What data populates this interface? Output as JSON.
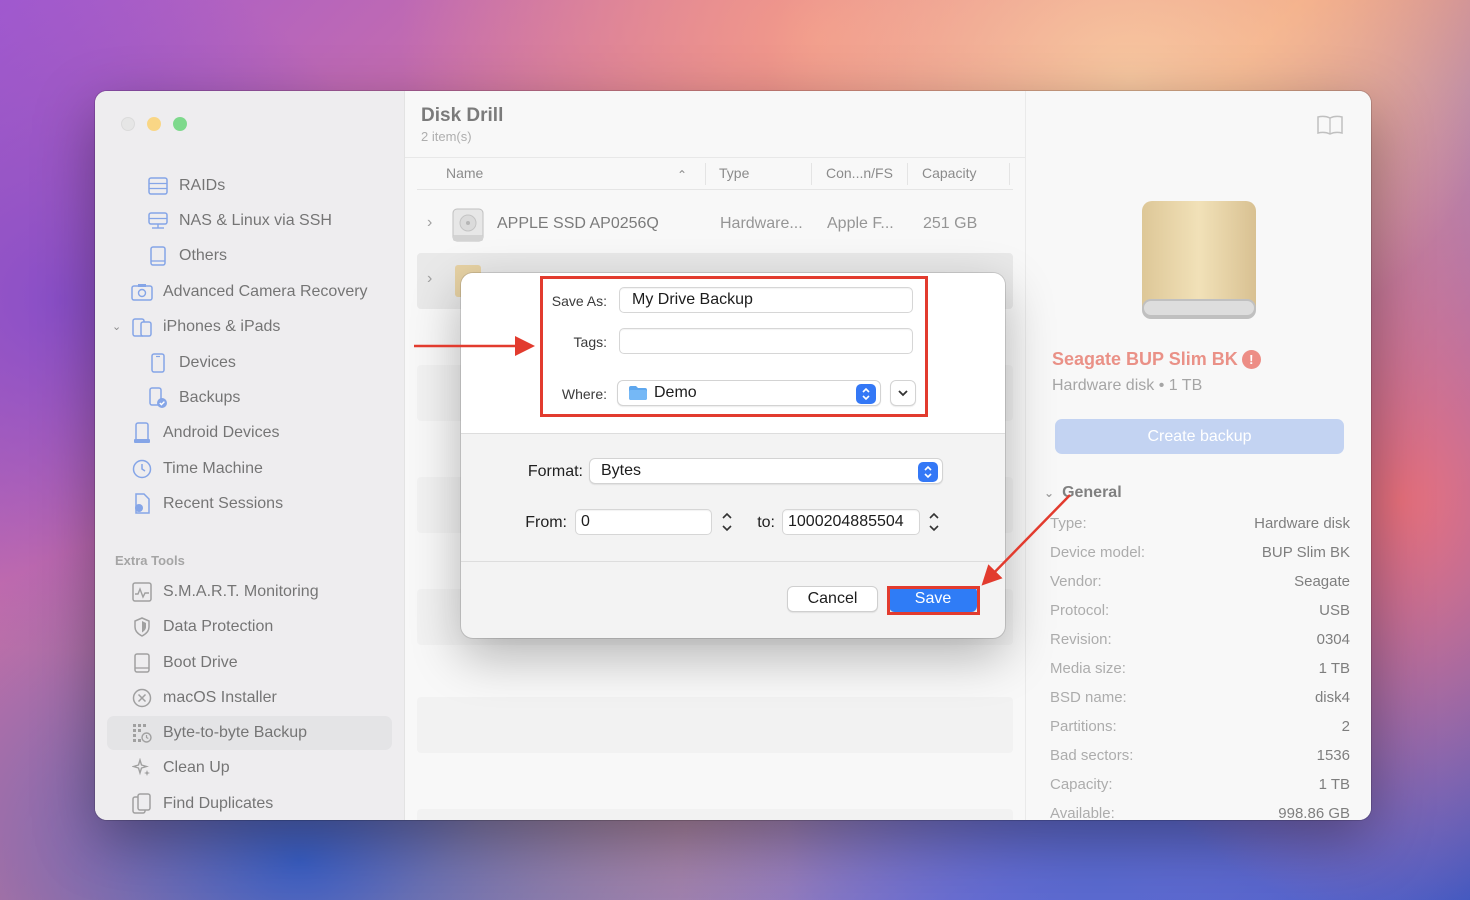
{
  "app": {
    "title": "Disk Drill",
    "subtitle": "2 item(s)"
  },
  "sidebar": {
    "items": [
      {
        "label": "RAIDs",
        "icon": "raid-icon"
      },
      {
        "label": "NAS & Linux via SSH",
        "icon": "nas-icon"
      },
      {
        "label": "Others",
        "icon": "tablet-icon"
      },
      {
        "label": "Advanced Camera Recovery",
        "icon": "camera-icon"
      },
      {
        "label": "iPhones & iPads",
        "icon": "phone-icon"
      },
      {
        "label": "Devices",
        "icon": "device-icon"
      },
      {
        "label": "Backups",
        "icon": "backup-icon"
      },
      {
        "label": "Android Devices",
        "icon": "android-icon"
      },
      {
        "label": "Time Machine",
        "icon": "time-machine-icon"
      },
      {
        "label": "Recent Sessions",
        "icon": "recent-sessions-icon"
      }
    ],
    "extra_tools_heading": "Extra Tools",
    "tools": [
      {
        "label": "S.M.A.R.T. Monitoring",
        "icon": "smart-icon"
      },
      {
        "label": "Data Protection",
        "icon": "shield-icon"
      },
      {
        "label": "Boot Drive",
        "icon": "boot-drive-icon"
      },
      {
        "label": "macOS Installer",
        "icon": "installer-icon"
      },
      {
        "label": "Byte-to-byte Backup",
        "icon": "byte-backup-icon"
      },
      {
        "label": "Clean Up",
        "icon": "sparkle-icon"
      },
      {
        "label": "Find Duplicates",
        "icon": "duplicates-icon"
      }
    ]
  },
  "table": {
    "columns": [
      "Name",
      "Type",
      "Con...n/FS",
      "Capacity"
    ],
    "rows": [
      {
        "name": "APPLE SSD AP0256Q",
        "type": "Hardware...",
        "fs": "Apple F...",
        "capacity": "251 GB"
      }
    ]
  },
  "details": {
    "device_name": "Seagate BUP Slim BK",
    "device_sub": "Hardware disk • 1 TB",
    "create_backup": "Create backup",
    "general_heading": "General",
    "props": [
      {
        "k": "Type:",
        "v": "Hardware disk"
      },
      {
        "k": "Device model:",
        "v": "BUP Slim BK"
      },
      {
        "k": "Vendor:",
        "v": "Seagate"
      },
      {
        "k": "Protocol:",
        "v": "USB"
      },
      {
        "k": "Revision:",
        "v": "0304"
      },
      {
        "k": "Media size:",
        "v": "1 TB"
      },
      {
        "k": "BSD name:",
        "v": "disk4"
      },
      {
        "k": "Partitions:",
        "v": "2"
      },
      {
        "k": "Bad sectors:",
        "v": "1536"
      },
      {
        "k": "Capacity:",
        "v": "1 TB"
      },
      {
        "k": "Available:",
        "v": "998.86 GB"
      }
    ]
  },
  "dialog": {
    "save_as_label": "Save As:",
    "save_as_value": "My Drive Backup",
    "tags_label": "Tags:",
    "tags_value": "",
    "where_label": "Where:",
    "where_value": "Demo",
    "format_label": "Format:",
    "format_value": "Bytes",
    "from_label": "From:",
    "from_value": "0",
    "to_label": "to:",
    "to_value": "1000204885504",
    "cancel_label": "Cancel",
    "save_label": "Save"
  },
  "colors": {
    "accent": "#2f7cf6",
    "annotation": "#e23b2e",
    "device_name": "#dd4e3e"
  }
}
